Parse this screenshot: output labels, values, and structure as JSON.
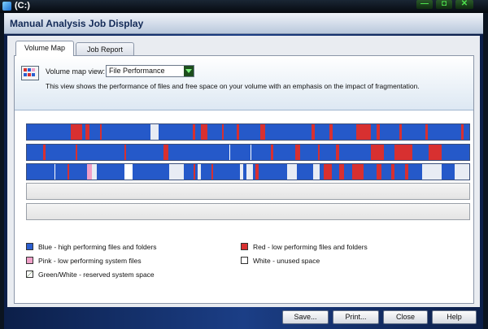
{
  "window": {
    "title": "(C:)",
    "minimize": "—",
    "maximize": "◘",
    "close": "✕"
  },
  "dialog": {
    "title": "Manual Analysis Job Display"
  },
  "tabs": [
    {
      "label": "Volume Map",
      "active": true
    },
    {
      "label": "Job Report",
      "active": false
    }
  ],
  "view": {
    "label": "Volume map view:",
    "selected": "File Performance",
    "description": "This view shows the performance of files and free space on your volume with an emphasis on the impact of fragmentation."
  },
  "legend": {
    "blue": {
      "label": "Blue - high performing files and folders",
      "color": "#2b5fd0"
    },
    "pink": {
      "label": "Pink - low performing system files",
      "color": "#f0a0c8"
    },
    "green": {
      "label": "Green/White - reserved system space",
      "color": "#e8f0e0"
    },
    "red": {
      "label": "Red - low performing files and folders",
      "color": "#d83030"
    },
    "white": {
      "label": "White - unused space",
      "color": "#ffffff"
    }
  },
  "buttons": {
    "save": "Save...",
    "print": "Print...",
    "close": "Close",
    "help": "Help"
  }
}
